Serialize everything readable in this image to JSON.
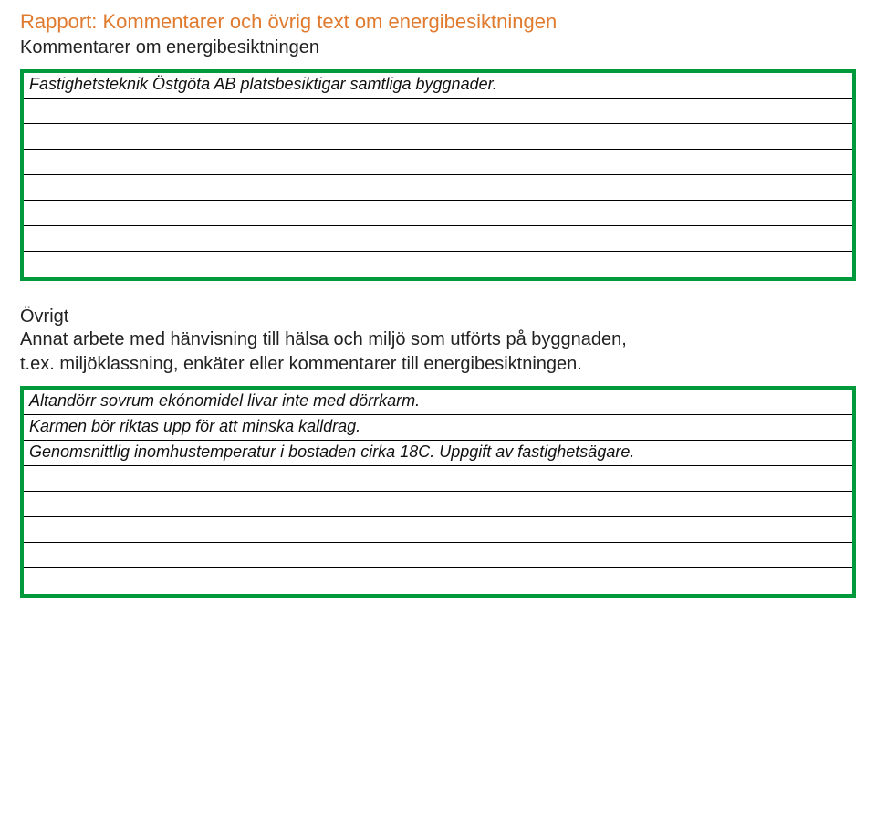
{
  "header": {
    "title": "Rapport: Kommentarer och övrig text om energibesiktningen",
    "subtitle": "Kommentarer om energibesiktningen"
  },
  "box1": {
    "lines": [
      "Fastighetsteknik Östgöta AB platsbesiktigar samtliga byggnader.",
      "",
      "",
      "",
      "",
      "",
      "",
      ""
    ]
  },
  "section2": {
    "head": "Övrigt",
    "desc1": "Annat arbete med hänvisning till hälsa och miljö som utförts på byggnaden,",
    "desc2": "t.ex. miljöklassning, enkäter eller kommentarer till energibesiktningen."
  },
  "box2": {
    "lines": [
      "Altandörr sovrum ekónomidel livar inte med dörrkarm.",
      "Karmen bör riktas upp för att minska kalldrag.",
      "Genomsnittlig inomhustemperatur i bostaden cirka 18C. Uppgift av fastighetsägare.",
      "",
      "",
      "",
      "",
      ""
    ]
  }
}
